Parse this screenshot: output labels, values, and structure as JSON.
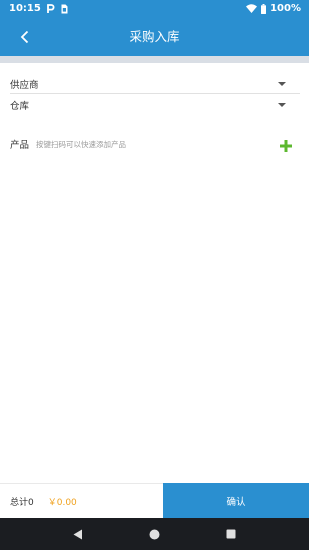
{
  "status_bar": {
    "time": "10:15",
    "battery": "100%",
    "icons": [
      "p-notification-icon",
      "sim-card-icon",
      "wifi-icon",
      "battery-icon"
    ]
  },
  "app_bar": {
    "title": "采购入库",
    "back_icon": "chevron-left-icon"
  },
  "form": {
    "supplier_label": "供应商",
    "warehouse_label": "仓库",
    "product_label": "产品",
    "product_hint": "按键扫码可以快速添加产品"
  },
  "footer": {
    "total_label": "总计0",
    "total_amount": "￥0.00",
    "confirm_label": "确认"
  },
  "nav_bar": {
    "icons": [
      "back-triangle-icon",
      "home-circle-icon",
      "recents-square-icon"
    ]
  },
  "colors": {
    "primary": "#2a8fd0",
    "add": "#5cb82f",
    "amount": "#f0a21f",
    "divider": "#d9dee5",
    "nav": "#1b1d21"
  }
}
